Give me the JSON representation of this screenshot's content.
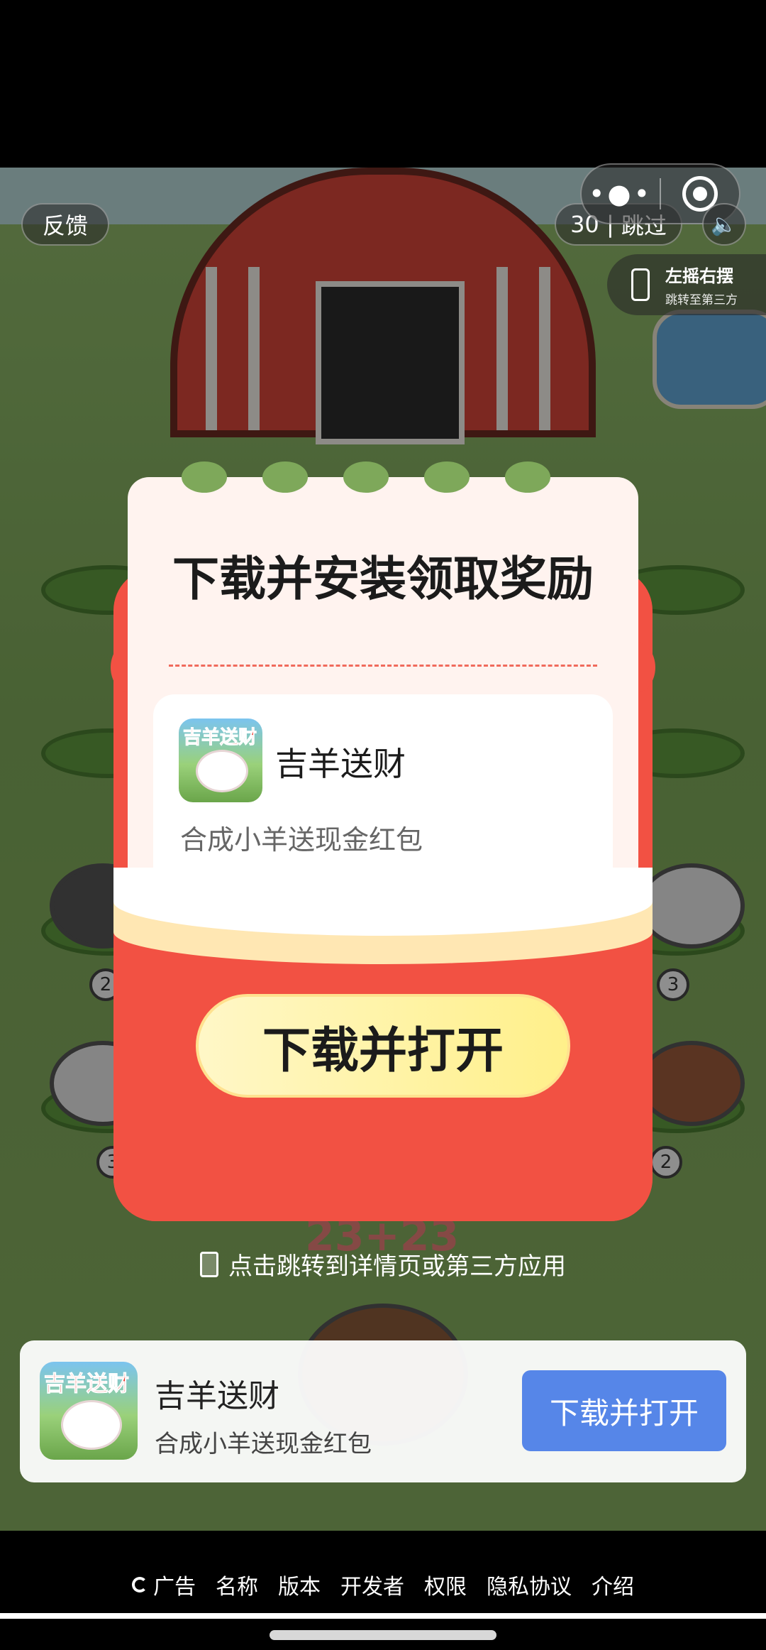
{
  "top_bar": {
    "feedback_label": "反馈",
    "countdown": "30",
    "skip_label": "跳过",
    "sound_icon": "speaker-icon",
    "menu_icon": "more-dots-icon",
    "close_icon": "target-icon"
  },
  "shake_tip": {
    "title": "左摇右摆",
    "subtitle": "跳转至第三方",
    "icon": "phone-icon"
  },
  "modal": {
    "title": "下载并安装领取奖励",
    "app_name": "吉羊送财",
    "app_desc": "合成小羊送现金红包",
    "app_icon_text": "吉羊送财",
    "cta_label": "下载并打开"
  },
  "background": {
    "equation": "23+23"
  },
  "hint": {
    "text": "点击跳转到详情页或第三方应用",
    "icon": "tablet-icon"
  },
  "banner": {
    "app_name": "吉羊送财",
    "app_desc": "合成小羊送现金红包",
    "app_icon_text": "吉羊送财",
    "button_label": "下载并打开",
    "button_color": "#5686e8"
  },
  "footer": {
    "links": [
      "广告",
      "名称",
      "版本",
      "开发者",
      "权限",
      "隐私协议",
      "介绍"
    ],
    "progress_fraction": 1.0
  },
  "colors": {
    "modal_red": "#f25143",
    "cta_yellow": "#fff08a",
    "backdrop_green": "#7ea85a"
  }
}
